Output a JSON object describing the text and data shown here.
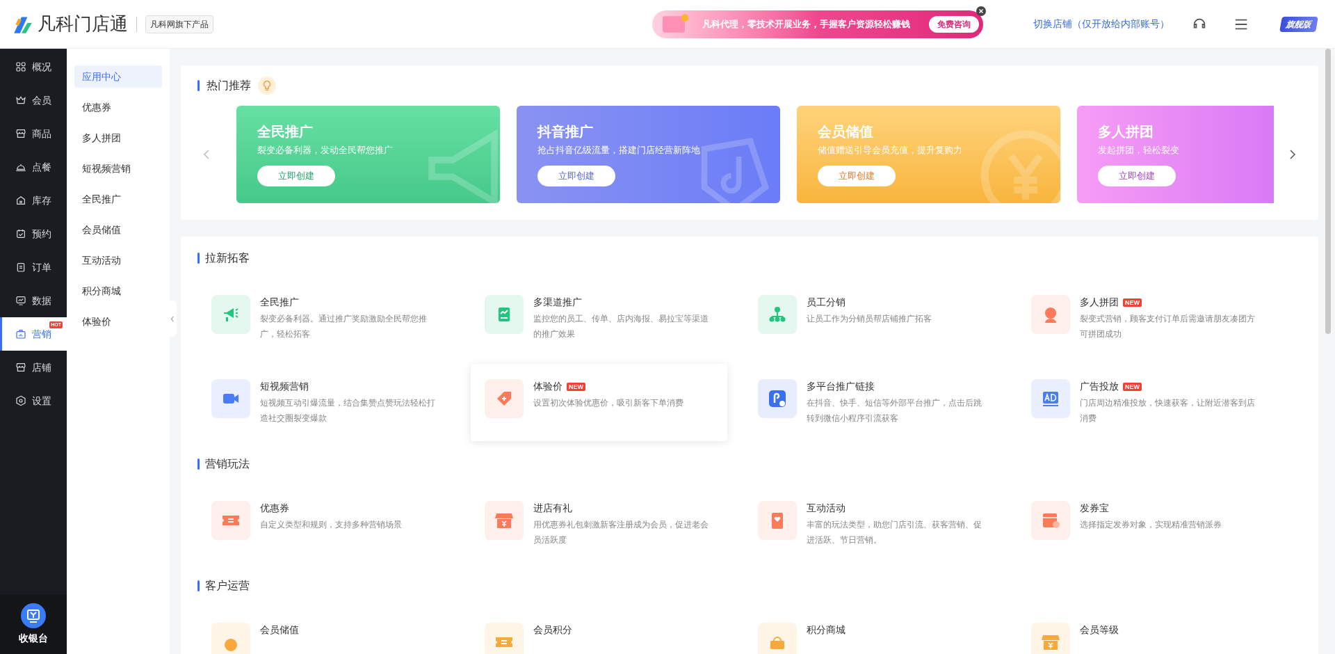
{
  "header": {
    "logo": "凡科门店通",
    "product_tag": "凡科网旗下产品",
    "ad": {
      "text": "凡科代理，零技术开展业务，手握客户资源轻松赚钱",
      "button": "免费咨询"
    },
    "switch_store": "切换店铺（仅开放给内部账号）",
    "edition": "旗舰版"
  },
  "nav": [
    {
      "label": "概况",
      "selected": false
    },
    {
      "label": "会员",
      "selected": false
    },
    {
      "label": "商品",
      "selected": false
    },
    {
      "label": "点餐",
      "selected": false
    },
    {
      "label": "库存",
      "selected": false
    },
    {
      "label": "预约",
      "selected": false
    },
    {
      "label": "订单",
      "selected": false
    },
    {
      "label": "数据",
      "selected": false
    },
    {
      "label": "营销",
      "selected": true,
      "badge": "HOT"
    },
    {
      "label": "店铺",
      "selected": false
    },
    {
      "label": "设置",
      "selected": false
    }
  ],
  "cashier": "收银台",
  "subnav": [
    {
      "label": "应用中心",
      "selected": true
    },
    {
      "label": "优惠券",
      "selected": false
    },
    {
      "label": "多人拼团",
      "selected": false
    },
    {
      "label": "短视频营销",
      "selected": false
    },
    {
      "label": "全民推广",
      "selected": false
    },
    {
      "label": "会员储值",
      "selected": false
    },
    {
      "label": "互动活动",
      "selected": false
    },
    {
      "label": "积分商城",
      "selected": false
    },
    {
      "label": "体验价",
      "selected": false
    }
  ],
  "hot": {
    "title": "热门推荐",
    "banners": [
      {
        "kind": "green",
        "title": "全民推广",
        "desc": "裂变必备利器，发动全民帮您推广",
        "button": "立即创建"
      },
      {
        "kind": "blue",
        "title": "抖音推广",
        "desc": "抢占抖音亿级流量，搭建门店经营新阵地",
        "button": "立即创建"
      },
      {
        "kind": "orange",
        "title": "会员储值",
        "desc": "储值赠送引导会员充值，提升复购力",
        "button": "立即创建"
      },
      {
        "kind": "pink",
        "title": "多人拼团",
        "desc": "发起拼团，轻松裂变",
        "button": "立即创建"
      }
    ]
  },
  "sections": [
    {
      "title": "拉新拓客",
      "items": [
        {
          "title": "全民推广",
          "desc": "裂变必备利器。通过推广奖励激励全民帮您推广，轻松拓客",
          "highlighted": false
        },
        {
          "title": "多渠道推广",
          "desc": "监控您的员工、传单、店内海报、易拉宝等渠道的推广效果",
          "highlighted": false
        },
        {
          "title": "员工分销",
          "desc": "让员工作为分销员帮店铺推广拓客",
          "highlighted": false
        },
        {
          "title": "多人拼团",
          "badge": "NEW",
          "desc": "裂变式营销，顾客支付订单后需邀请朋友凑团方可拼团成功",
          "highlighted": false
        },
        {
          "title": "短视频营销",
          "desc": "短视频互动引爆流量，结合集赞点赞玩法轻松打造社交圈裂变爆款",
          "highlighted": false
        },
        {
          "title": "体验价",
          "badge": "NEW",
          "desc": "设置初次体验优惠价，吸引新客下单消费",
          "highlighted": true
        },
        {
          "title": "多平台推广链接",
          "desc": "在抖音、快手、短信等外部平台推广，点击后跳转到微信小程序引流获客",
          "highlighted": false
        },
        {
          "title": "广告投放",
          "badge": "NEW",
          "desc": "门店周边精准投放，快速获客，让附近潜客到店消费",
          "highlighted": false
        }
      ]
    },
    {
      "title": "营销玩法",
      "items": [
        {
          "title": "优惠券",
          "desc": "自定义类型和规则，支持多种营销场景",
          "highlighted": false
        },
        {
          "title": "进店有礼",
          "desc": "用优惠券礼包刺激新客注册成为会员，促进老会员活跃度",
          "highlighted": false
        },
        {
          "title": "互动活动",
          "desc": "丰富的玩法类型，助您门店引流、获客营销、促进活跃、节日营销。",
          "highlighted": false
        },
        {
          "title": "发券宝",
          "desc": "选择指定发券对象，实现精准营销派券",
          "highlighted": false
        }
      ]
    },
    {
      "title": "客户运营",
      "items": [
        {
          "title": "会员储值",
          "highlighted": false
        },
        {
          "title": "会员积分",
          "highlighted": false
        },
        {
          "title": "积分商城",
          "highlighted": false
        },
        {
          "title": "会员等级",
          "highlighted": false
        }
      ]
    }
  ]
}
